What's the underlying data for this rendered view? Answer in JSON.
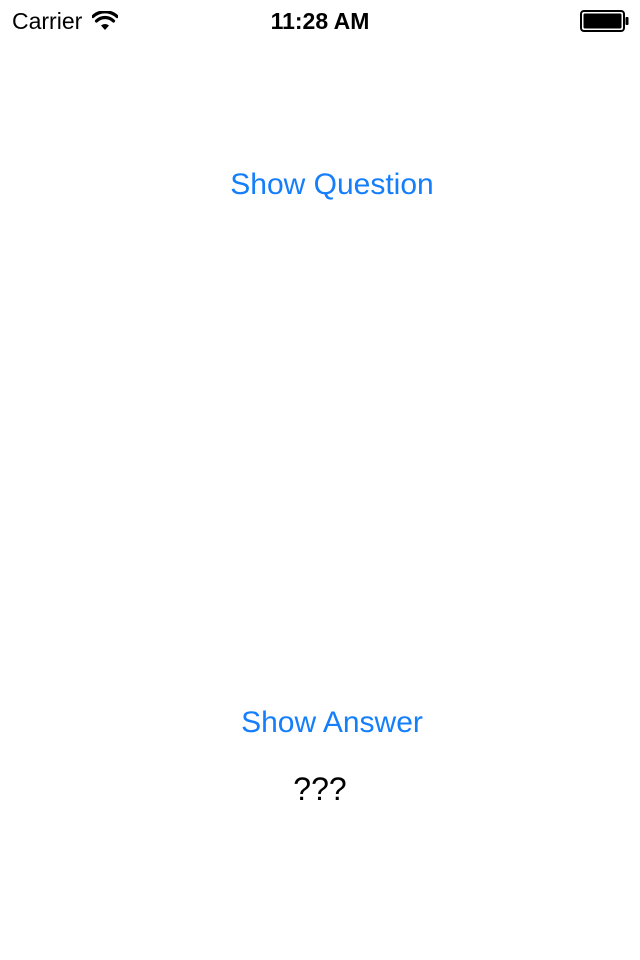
{
  "status_bar": {
    "carrier": "Carrier",
    "time": "11:28 AM",
    "wifi_icon": "wifi-icon",
    "battery_icon": "battery-full-icon"
  },
  "main": {
    "show_question_label": "Show Question",
    "show_answer_label": "Show Answer",
    "answer_text": "???"
  },
  "colors": {
    "accent": "#147EFB",
    "background": "#FFFFFF",
    "text": "#000000"
  }
}
